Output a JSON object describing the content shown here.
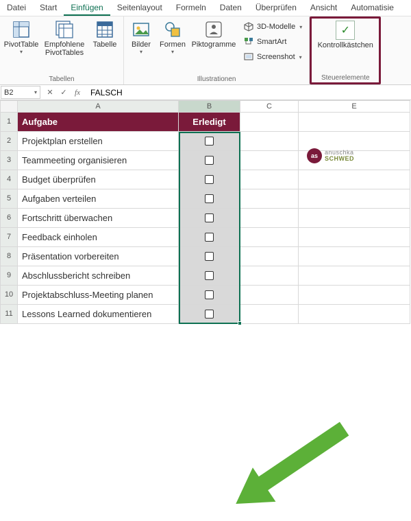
{
  "menu_tabs": {
    "datei": "Datei",
    "start": "Start",
    "einfuegen": "Einfügen",
    "seitenlayout": "Seitenlayout",
    "formeln": "Formeln",
    "daten": "Daten",
    "ueberpruefen": "Überprüfen",
    "ansicht": "Ansicht",
    "automatisieren": "Automatisie"
  },
  "ribbon": {
    "tabellen": {
      "pivot": "PivotTable",
      "empfohlene": "Empfohlene\nPivotTables",
      "tabelle": "Tabelle",
      "group": "Tabellen"
    },
    "illustrationen": {
      "bilder": "Bilder",
      "formen": "Formen",
      "pikto": "Piktogramme",
      "models": "3D-Modelle",
      "smartart": "SmartArt",
      "screenshot": "Screenshot",
      "group": "Illustrationen"
    },
    "steuer": {
      "kontrollkaestchen": "Kontrollkästchen",
      "group": "Steuerelemente"
    }
  },
  "namebox": {
    "ref": "B2",
    "value": "FALSCH"
  },
  "columns": {
    "A": "A",
    "B": "B",
    "C": "C",
    "E": "E"
  },
  "headers": {
    "task": "Aufgabe",
    "done": "Erledigt"
  },
  "rows": [
    {
      "n": 1
    },
    {
      "n": 2,
      "task": "Projektplan erstellen"
    },
    {
      "n": 3,
      "task": "Teammeeting organisieren"
    },
    {
      "n": 4,
      "task": "Budget überprüfen"
    },
    {
      "n": 5,
      "task": "Aufgaben verteilen"
    },
    {
      "n": 6,
      "task": "Fortschritt überwachen"
    },
    {
      "n": 7,
      "task": "Feedback einholen"
    },
    {
      "n": 8,
      "task": "Präsentation vorbereiten"
    },
    {
      "n": 9,
      "task": "Abschlussbericht schreiben"
    },
    {
      "n": 10,
      "task": "Projektabschluss-Meeting planen"
    },
    {
      "n": 11,
      "task": "Lessons Learned dokumentieren"
    }
  ],
  "logo": {
    "badge": "as",
    "line1": "anuschka",
    "line2": "SCHWED"
  },
  "chart_data": {
    "type": "table",
    "title": "Aufgabenliste",
    "columns": [
      "Aufgabe",
      "Erledigt"
    ],
    "rows": [
      [
        "Projektplan erstellen",
        false
      ],
      [
        "Teammeeting organisieren",
        false
      ],
      [
        "Budget überprüfen",
        false
      ],
      [
        "Aufgaben verteilen",
        false
      ],
      [
        "Fortschritt überwachen",
        false
      ],
      [
        "Feedback einholen",
        false
      ],
      [
        "Präsentation vorbereiten",
        false
      ],
      [
        "Abschlussbericht schreiben",
        false
      ],
      [
        "Projektabschluss-Meeting planen",
        false
      ],
      [
        "Lessons Learned dokumentieren",
        false
      ]
    ]
  }
}
